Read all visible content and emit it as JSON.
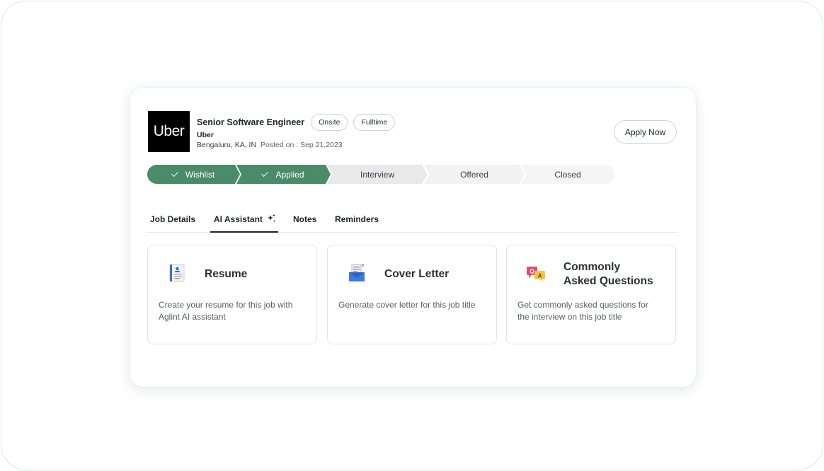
{
  "job": {
    "logo_text": "Uber",
    "title": "Senior Software Engineer",
    "tags": [
      "Onsite",
      "Fulltime"
    ],
    "company": "Uber",
    "location": "Bengaluru, KA, IN",
    "posted": "Posted on : Sep 21,2023",
    "apply_label": "Apply Now"
  },
  "stepper": {
    "steps": [
      {
        "label": "Wishlist",
        "done": true
      },
      {
        "label": "Applied",
        "done": true
      },
      {
        "label": "Interview",
        "done": false
      },
      {
        "label": "Offered",
        "done": false
      },
      {
        "label": "Closed",
        "done": false
      }
    ],
    "colors": {
      "done": "#4a8c69",
      "todo": "#eceef0"
    }
  },
  "tabs": {
    "items": [
      "Job Details",
      "AI Assistant",
      "Notes",
      "Reminders"
    ],
    "active": "AI Assistant"
  },
  "features": [
    {
      "title": "Resume",
      "description": "Create your resume for this job with Aglint AI assistant",
      "icon": "resume-document-icon"
    },
    {
      "title": "Cover Letter",
      "description": "Generate cover letter for this job title",
      "icon": "envelope-letter-icon"
    },
    {
      "title": "Commonly Asked Questions",
      "title_line1": "Commonly",
      "title_line2": "Asked Questions",
      "description": "Get commonly asked questions for the interview on this job title",
      "icon": "qa-chat-icon"
    }
  ]
}
